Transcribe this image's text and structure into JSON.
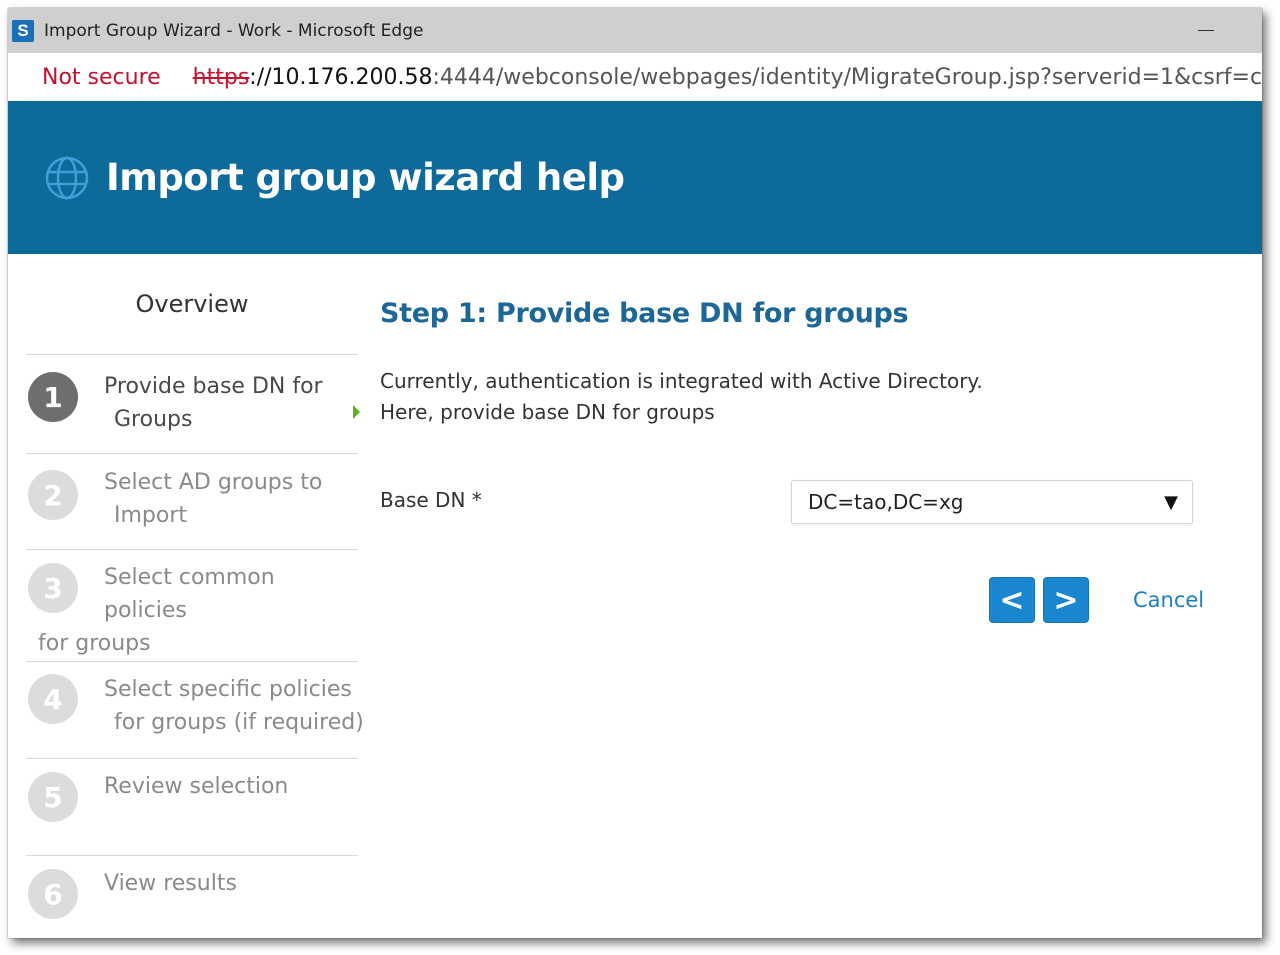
{
  "window": {
    "title": "Import Group Wizard - Work - Microsoft Edge",
    "app_icon_letter": "S"
  },
  "addressbar": {
    "security_label": "Not secure",
    "url_scheme": "https",
    "url_host": "://10.176.200.58",
    "url_rest": ":4444/webconsole/webpages/identity/MigrateGroup.jsp?serverid=1&csrf=c"
  },
  "banner": {
    "title": "Import group wizard help",
    "icon": "globe-icon"
  },
  "sidebar": {
    "heading": "Overview",
    "steps": [
      {
        "number": "1",
        "line1": "Provide base DN for",
        "line2": "Groups",
        "active": true
      },
      {
        "number": "2",
        "line1": "Select AD groups to",
        "line2": "Import",
        "active": false
      },
      {
        "number": "3",
        "line1": "Select common",
        "line2": "policies",
        "line3": "for groups",
        "active": false
      },
      {
        "number": "4",
        "line1": "Select specific policies",
        "line2": "for groups (if required)",
        "active": false
      },
      {
        "number": "5",
        "line1": "Review selection",
        "active": false
      },
      {
        "number": "6",
        "line1": "View results",
        "active": false
      }
    ]
  },
  "main": {
    "step_title": "Step 1: Provide base DN for groups",
    "description_line1": "Currently, authentication is integrated with Active Directory.",
    "description_line2": "Here, provide base DN for groups",
    "base_dn_label": "Base DN *",
    "base_dn_value": "DC=tao,DC=xg",
    "back_button": "<",
    "next_button": ">",
    "cancel_label": "Cancel"
  },
  "colors": {
    "banner": "#0d6a9b",
    "accent": "#1a86cf",
    "title_blue": "#1d6797",
    "warning_red": "#c8102e"
  }
}
